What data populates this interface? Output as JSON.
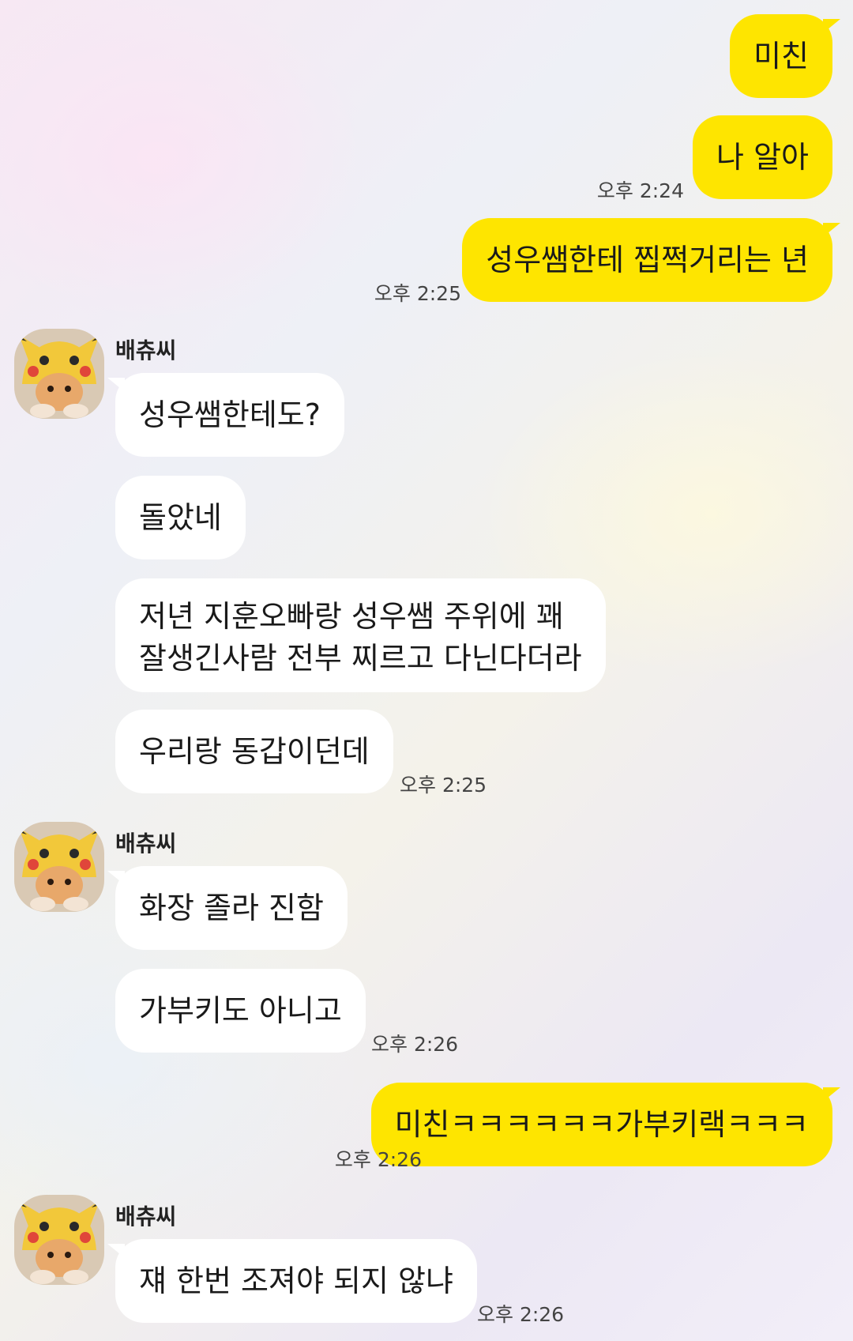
{
  "sender_name": "배츄씨",
  "messages": [
    {
      "from": "me",
      "text": "미친"
    },
    {
      "from": "me",
      "text": "나 알아",
      "time": "오후 2:24"
    },
    {
      "from": "me",
      "text": "성우쌤한테 찝쩍거리는 년",
      "time": "오후 2:25"
    },
    {
      "from": "other",
      "text": "성우쌤한테도?"
    },
    {
      "from": "other",
      "text": "돌았네"
    },
    {
      "from": "other",
      "lines": [
        "저년 지훈오빠랑 성우쌤 주위에 꽤",
        "잘생긴사람 전부 찌르고 다닌다더라"
      ]
    },
    {
      "from": "other",
      "text": "우리랑 동갑이던데",
      "time": "오후 2:25"
    },
    {
      "from": "other",
      "text": "화장 졸라 진함"
    },
    {
      "from": "other",
      "text": "가부키도 아니고",
      "time": "오후 2:26"
    },
    {
      "from": "me",
      "text": "미친ㅋㅋㅋㅋㅋㅋ가부키랙ㅋㅋㅋ",
      "time": "오후 2:26"
    },
    {
      "from": "other",
      "text": "쟤 한번 조져야 되지 않냐",
      "time": "오후 2:26"
    }
  ],
  "colors": {
    "mine_bubble": "#fee500",
    "other_bubble": "#ffffff"
  },
  "avatar_icon": "cat-in-pikachu-hood"
}
